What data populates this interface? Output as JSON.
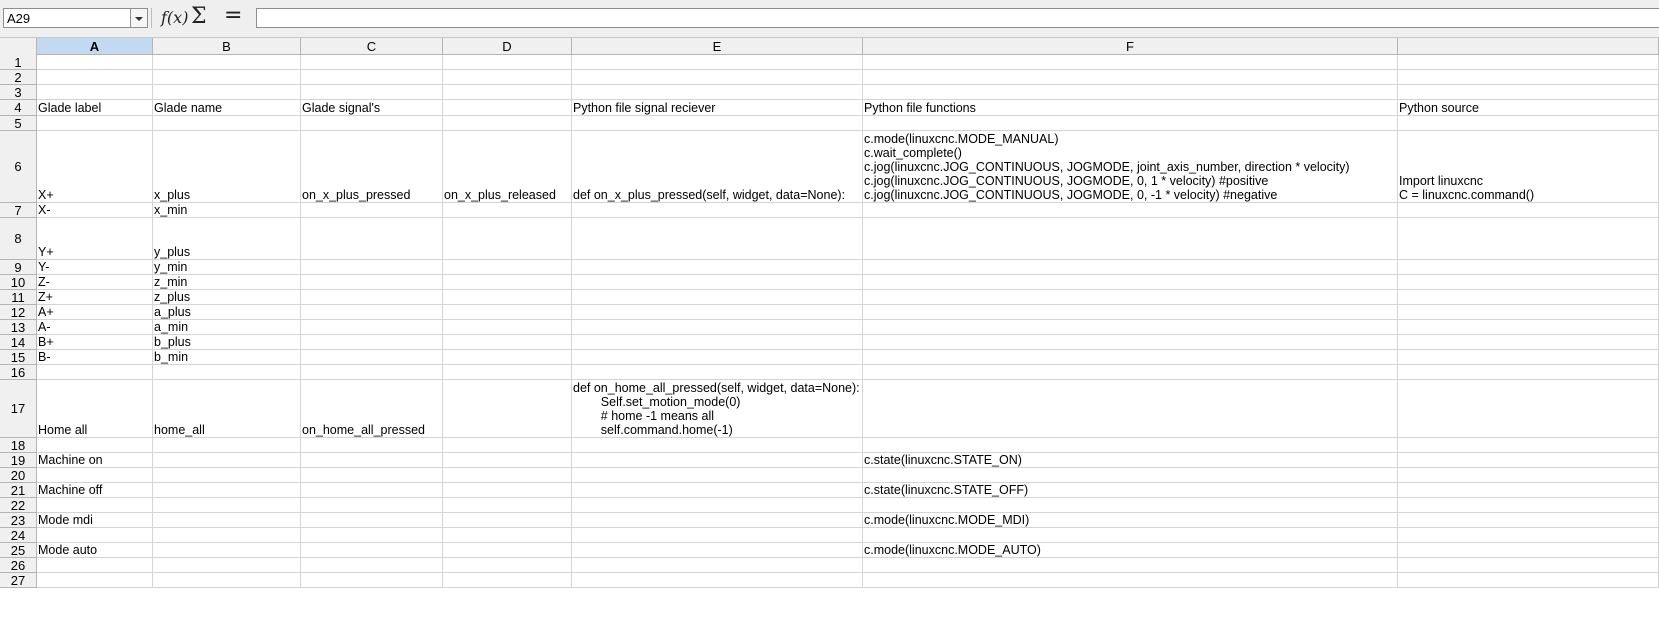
{
  "formula_bar": {
    "name_box": "A29",
    "formula": ""
  },
  "colors": {
    "header_bg": "#f0f0f0",
    "selected_header_bg": "#c3d9f2",
    "grid_line": "#d4d4d4",
    "spell_underline": "#d22222"
  },
  "columns": [
    "A",
    "B",
    "C",
    "D",
    "E",
    "F",
    ""
  ],
  "rows": {
    "r1": {
      "num": "1"
    },
    "r2": {
      "num": "2"
    },
    "r3": {
      "num": "3"
    },
    "r4": {
      "num": "4",
      "a": "Glade label",
      "b": "Glade name",
      "c": "Glade signal's",
      "e": "Python file signal reciever",
      "f": "Python file functions",
      "g": "Python source"
    },
    "r5": {
      "num": "5"
    },
    "r6": {
      "num": "6",
      "a": "X+",
      "b": "x_plus",
      "c": "on_x_plus_pressed",
      "d": "on_x_plus_released",
      "e": "def on_x_plus_pressed(self, widget, data=None):",
      "f1": "c.mode(linuxcnc.MODE_MANUAL)",
      "f2": "c.wait_complete()",
      "f3": "c.jog(linuxcnc.JOG_CONTINUOUS, JOGMODE, joint_axis_number, direction * velocity)",
      "f4": "c.jog(linuxcnc.JOG_CONTINUOUS, JOGMODE, 0, 1 * velocity) #positive",
      "f5": "c.jog(linuxcnc.JOG_CONTINUOUS, JOGMODE, 0, -1 * velocity) #negative",
      "g1": "Import linuxcnc",
      "g2": "C = linuxcnc.command()"
    },
    "r7": {
      "num": "7",
      "a": "X-",
      "b": "x_min"
    },
    "r8": {
      "num": "8",
      "a": "Y+",
      "b": "y_plus"
    },
    "r9": {
      "num": "9",
      "a": "Y-",
      "b": "y_min"
    },
    "r10": {
      "num": "10",
      "a": "Z-",
      "b": "z_min"
    },
    "r11": {
      "num": "11",
      "a": "Z+",
      "b": "z_plus"
    },
    "r12": {
      "num": "12",
      "a": "A+",
      "b": "a_plus"
    },
    "r13": {
      "num": "13",
      "a": "A-",
      "b": "a_min"
    },
    "r14": {
      "num": "14",
      "a": "B+",
      "b": "b_plus"
    },
    "r15": {
      "num": "15",
      "a": "B-",
      "b": "b_min"
    },
    "r16": {
      "num": "16"
    },
    "r17": {
      "num": "17",
      "a": "Home all",
      "b": "home_all",
      "c": "on_home_all_pressed",
      "e1": "def on_home_all_pressed(self, widget, data=None):",
      "e2": "        Self.set_motion_mode(0)",
      "e3": "        # home -1 means all",
      "e4": "        self.command.home(-1)"
    },
    "r18": {
      "num": "18"
    },
    "r19": {
      "num": "19",
      "a": "Machine on",
      "f": "c.state(linuxcnc.STATE_ON)"
    },
    "r20": {
      "num": "20"
    },
    "r21": {
      "num": "21",
      "a": "Machine off",
      "f": "c.state(linuxcnc.STATE_OFF)"
    },
    "r22": {
      "num": "22"
    },
    "r23": {
      "num": "23",
      "a": "Mode mdi",
      "f": "c.mode(linuxcnc.MODE_MDI)"
    },
    "r24": {
      "num": "24"
    },
    "r25": {
      "num": "25",
      "a": "Mode auto",
      "f": "c.mode(linuxcnc.MODE_AUTO)"
    },
    "r26": {
      "num": "26"
    },
    "r27": {
      "num": "27"
    }
  }
}
